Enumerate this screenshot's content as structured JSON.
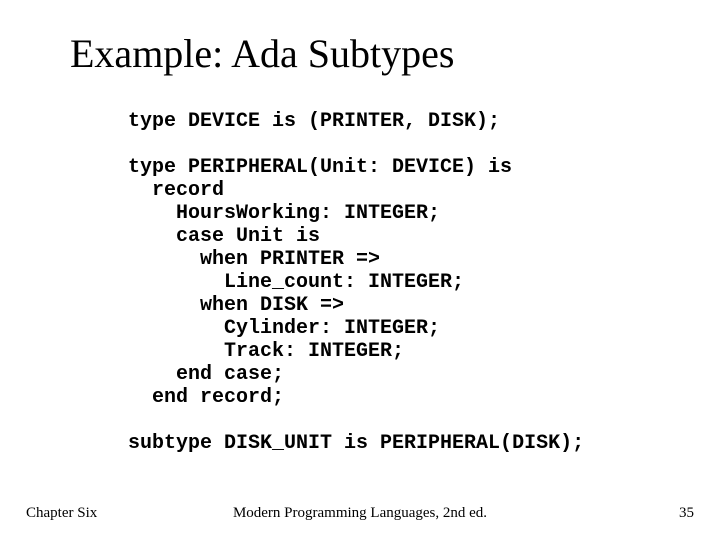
{
  "title": "Example: Ada Subtypes",
  "code": "type DEVICE is (PRINTER, DISK);\n\ntype PERIPHERAL(Unit: DEVICE) is\n  record\n    HoursWorking: INTEGER;\n    case Unit is\n      when PRINTER =>\n        Line_count: INTEGER;\n      when DISK =>\n        Cylinder: INTEGER;\n        Track: INTEGER;\n    end case;\n  end record;\n\nsubtype DISK_UNIT is PERIPHERAL(DISK);",
  "footer": {
    "left": "Chapter Six",
    "center": "Modern Programming Languages, 2nd ed.",
    "right": "35"
  }
}
